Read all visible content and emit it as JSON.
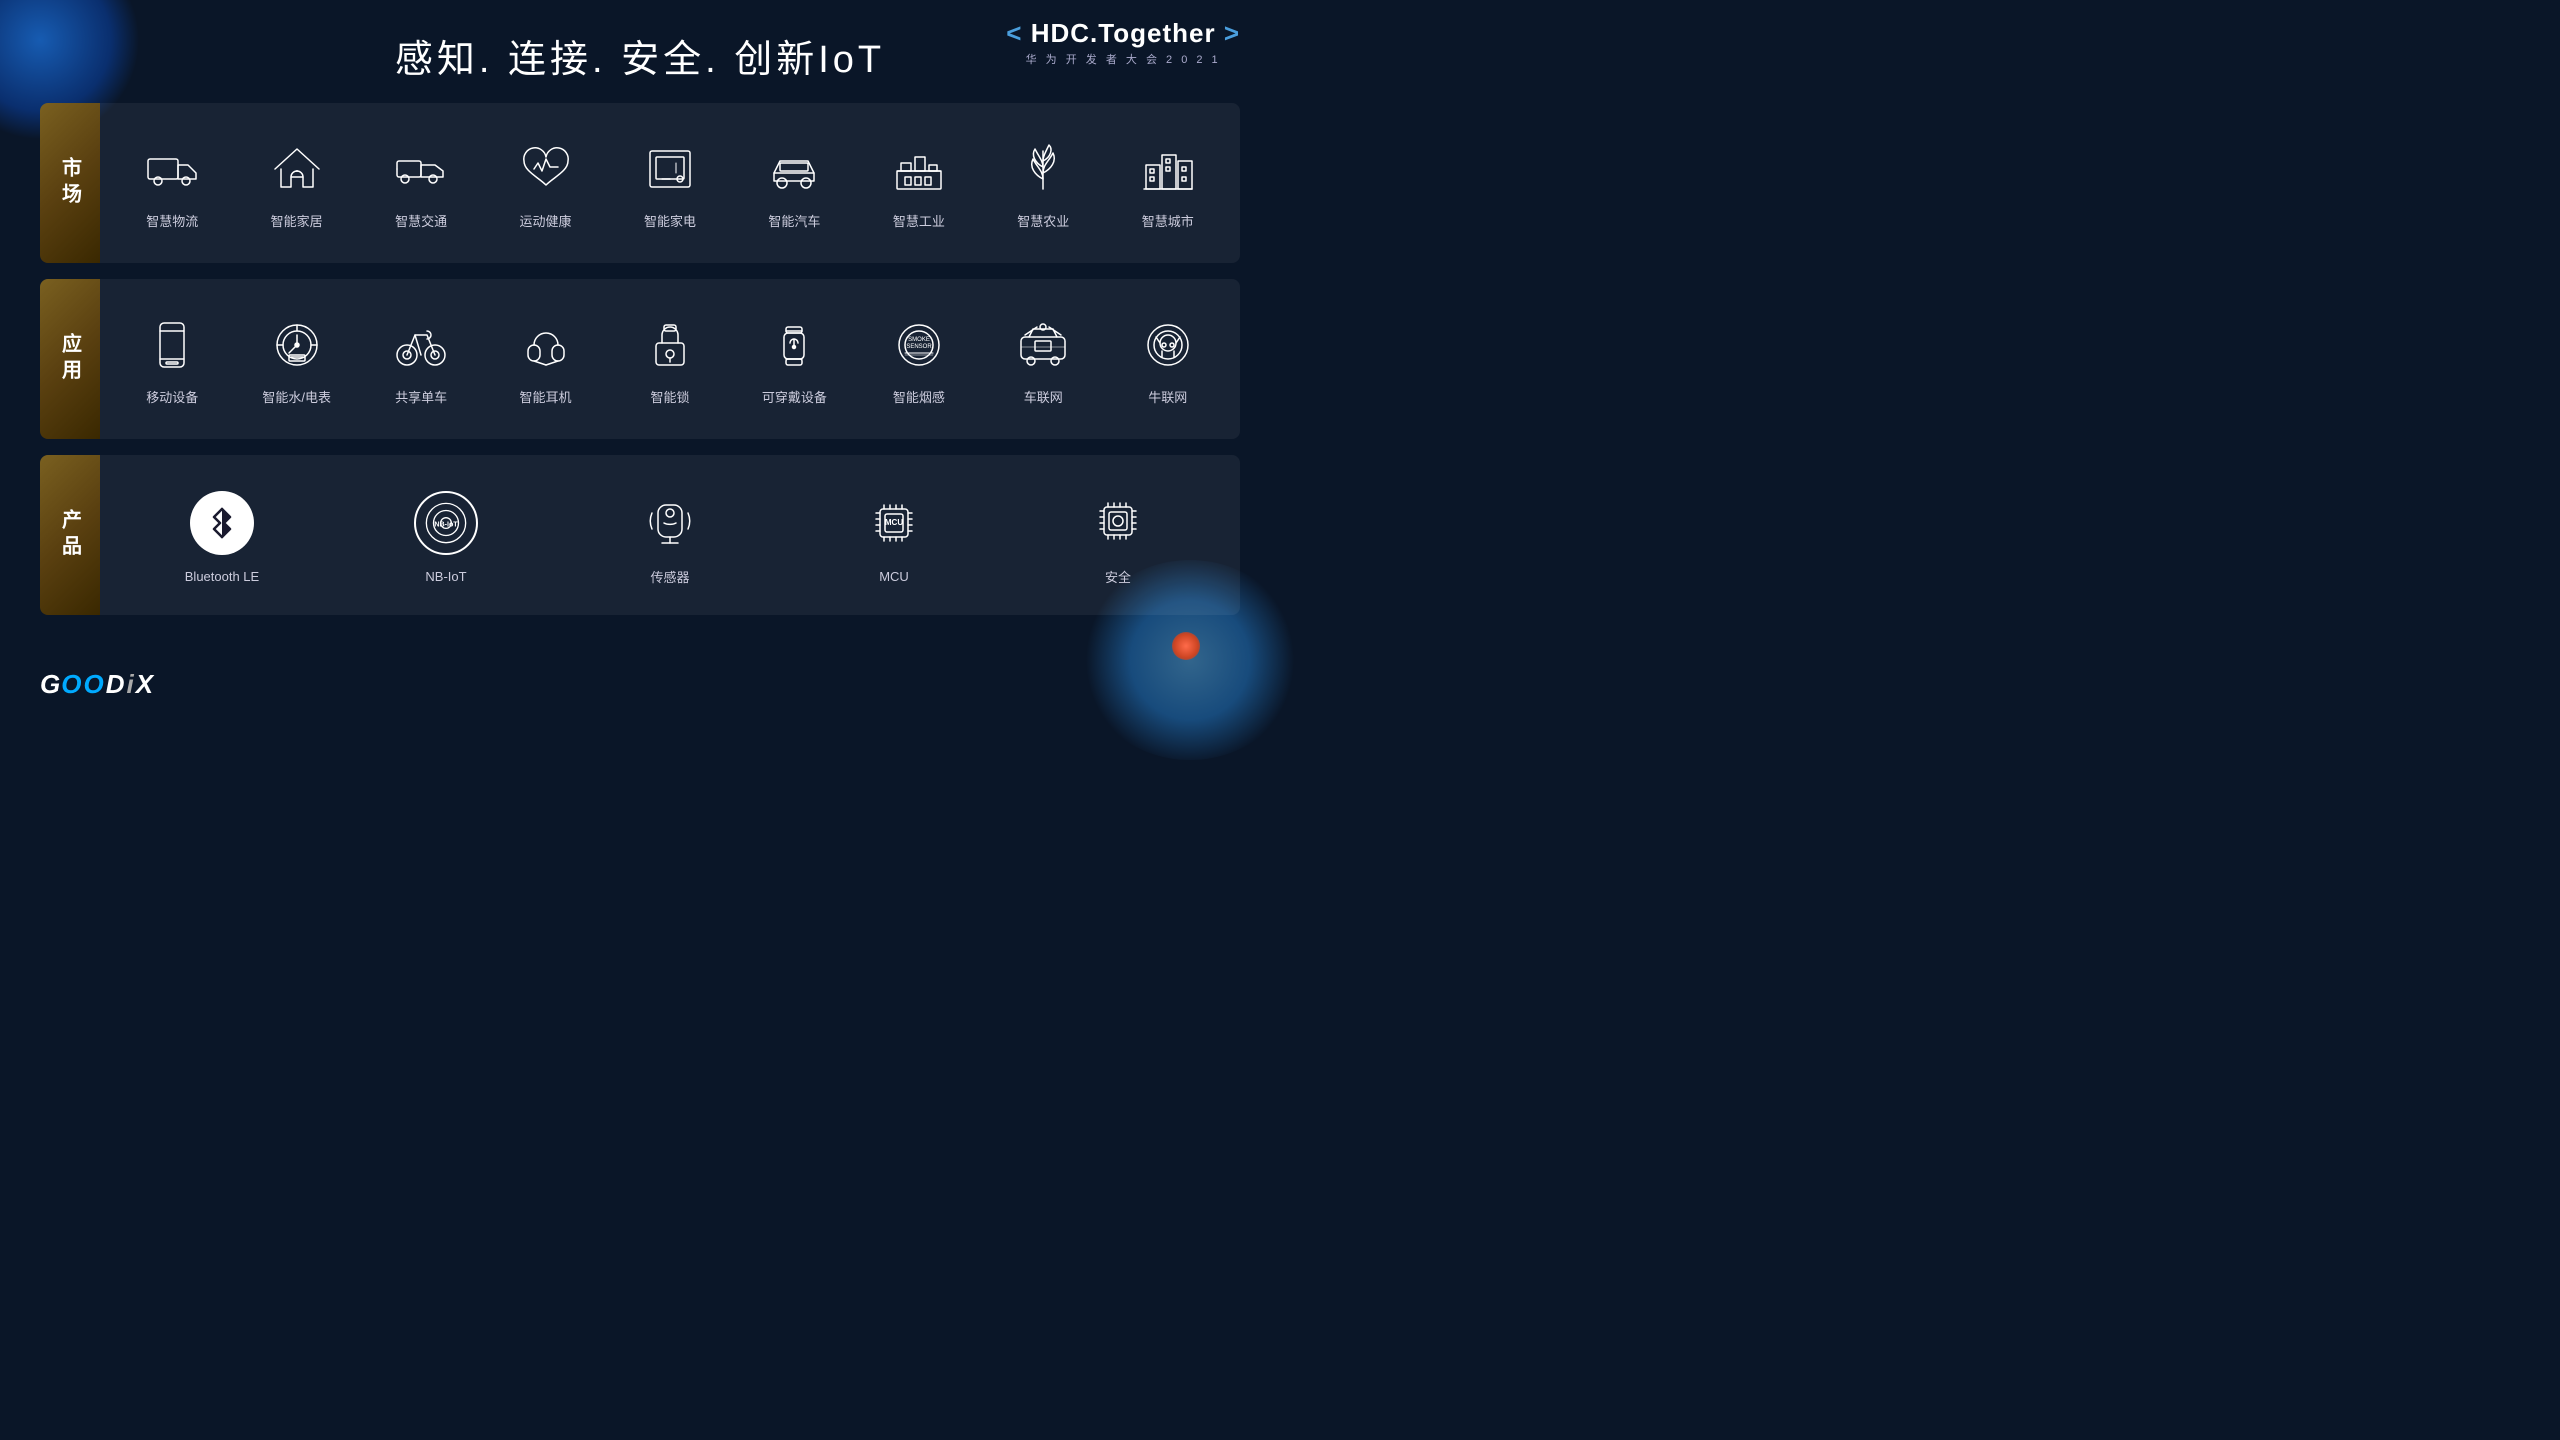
{
  "header": {
    "title": "感知. 连接. 安全. 创新IoT",
    "hdc_brand": "HDC.Together",
    "hdc_sub": "华 为 开 发 者 大 会 2 0 2 1",
    "bracket_left": "<",
    "bracket_right": ">"
  },
  "rows": [
    {
      "id": "market",
      "label": "市\n场",
      "items": [
        {
          "id": "logistics",
          "label": "智慧物流",
          "icon": "truck"
        },
        {
          "id": "smarthome",
          "label": "智能家居",
          "icon": "home"
        },
        {
          "id": "traffic",
          "label": "智慧交通",
          "icon": "traffic"
        },
        {
          "id": "health",
          "label": "运动健康",
          "icon": "heart"
        },
        {
          "id": "appliance",
          "label": "智能家电",
          "icon": "appliance"
        },
        {
          "id": "auto",
          "label": "智能汽车",
          "icon": "car"
        },
        {
          "id": "industry",
          "label": "智慧工业",
          "icon": "factory"
        },
        {
          "id": "agri",
          "label": "智慧农业",
          "icon": "wheat"
        },
        {
          "id": "city",
          "label": "智慧城市",
          "icon": "city"
        }
      ]
    },
    {
      "id": "application",
      "label": "应\n用",
      "items": [
        {
          "id": "mobile",
          "label": "移动设备",
          "icon": "phone"
        },
        {
          "id": "meter",
          "label": "智能水/电表",
          "icon": "meter"
        },
        {
          "id": "bike",
          "label": "共享单车",
          "icon": "bike"
        },
        {
          "id": "earphone",
          "label": "智能耳机",
          "icon": "earphone"
        },
        {
          "id": "lock",
          "label": "智能锁",
          "icon": "lock"
        },
        {
          "id": "wearable",
          "label": "可穿戴设备",
          "icon": "watch"
        },
        {
          "id": "smoke",
          "label": "智能烟感",
          "icon": "smoke"
        },
        {
          "id": "vehicle",
          "label": "车联网",
          "icon": "vehiclenet"
        },
        {
          "id": "cattle",
          "label": "牛联网",
          "icon": "cattle"
        }
      ]
    },
    {
      "id": "product",
      "label": "产\n品",
      "items": [
        {
          "id": "bluetooth",
          "label": "Bluetooth LE",
          "icon": "bluetooth"
        },
        {
          "id": "nbiot",
          "label": "NB-IoT",
          "icon": "nbiot"
        },
        {
          "id": "sensor",
          "label": "传感器",
          "icon": "sensor"
        },
        {
          "id": "mcu",
          "label": "MCU",
          "icon": "mcu"
        },
        {
          "id": "security",
          "label": "安全",
          "icon": "security"
        }
      ]
    }
  ],
  "logo": "GOODiX"
}
